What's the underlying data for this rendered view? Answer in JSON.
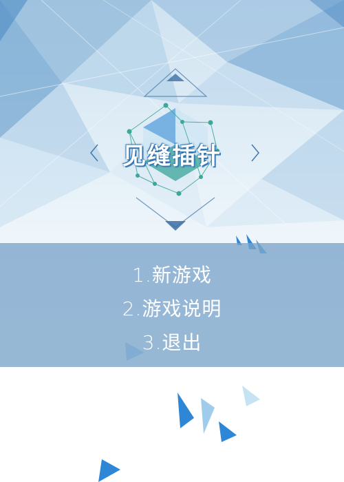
{
  "game": {
    "title": "见缝插针"
  },
  "menu": {
    "items": [
      {
        "label": "1.新游戏"
      },
      {
        "label": "2.游戏说明"
      },
      {
        "label": "3.退出"
      }
    ]
  },
  "colors": {
    "accent_blue": "#2e86d6",
    "menu_band": "#7aa4c9",
    "text": "#ffffff",
    "logo_green": "#3fa79a"
  },
  "icons": {
    "left_arrow": "chevron-left-icon",
    "right_arrow": "chevron-right-icon"
  }
}
